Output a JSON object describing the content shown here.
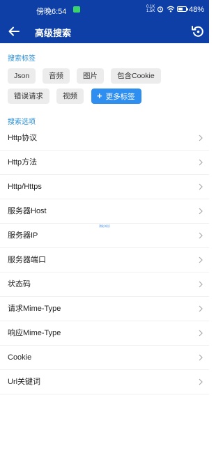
{
  "status_bar": {
    "time": "傍晚6:54",
    "net_speed_top": "0.1K",
    "net_speed_bottom": "1.5K",
    "battery": "48%",
    "icons": [
      "message-icon",
      "alarm-icon",
      "wifi-icon",
      "battery-icon"
    ]
  },
  "app_bar": {
    "title": "高级搜索",
    "back_icon": "arrow-left-icon",
    "reset_icon": "reset-icon"
  },
  "tags_section": {
    "title": "搜索标签",
    "tags": [
      "Json",
      "音频",
      "图片",
      "包含Cookie",
      "错误请求",
      "视频"
    ],
    "more_label": "更多标签"
  },
  "options_section": {
    "title": "搜索选项",
    "items": [
      "Http协议",
      "Http方法",
      "Http/Https",
      "服务器Host",
      "服务器IP",
      "服务器端口",
      "状态码",
      "请求Mime-Type",
      "响应Mime-Type",
      "Cookie",
      "Url关键词"
    ]
  },
  "watermark": "滑彩知识",
  "colors": {
    "primary": "#0d3fa6",
    "accent": "#2f8ff0",
    "section_title": "#2b8fd6",
    "tag_bg": "#ececec"
  }
}
